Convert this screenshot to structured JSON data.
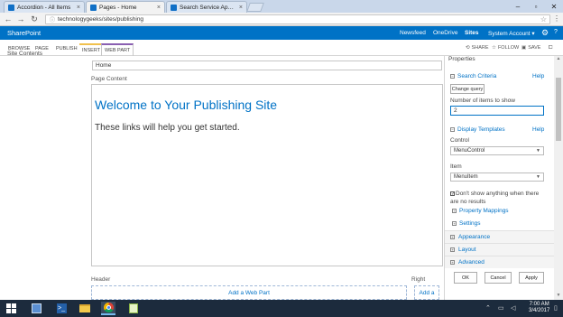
{
  "browser": {
    "tabs": [
      {
        "label": "Accordion - All Items",
        "active": false
      },
      {
        "label": "Pages - Home",
        "active": true
      },
      {
        "label": "Search Service Applicati",
        "active": false
      }
    ],
    "url": "technologygeeks/sites/publishing"
  },
  "suitebar": {
    "brand": "SharePoint",
    "links": [
      "Newsfeed",
      "OneDrive",
      "Sites"
    ],
    "account": "System Account ▾",
    "help": "?"
  },
  "ribbon": {
    "tabs": [
      "BROWSE",
      "PAGE",
      "PUBLISH",
      "INSERT",
      "WEB PART"
    ],
    "actions": [
      "SHARE",
      "FOLLOW",
      "SAVE"
    ]
  },
  "leftnav": {
    "item": "Site Contents"
  },
  "main": {
    "title_value": "Home",
    "content_label": "Page Content",
    "welcome": "Welcome to Your Publishing Site",
    "links_text": "These links will help you get started.",
    "header_label": "Header",
    "right_label": "Right",
    "add_web_part": "Add a Web Part",
    "add_web_part_short": "Add a"
  },
  "toolpane": {
    "title": "Properties",
    "search_criteria": "Search Criteria",
    "help": "Help",
    "change_query": "Change query",
    "items_label": "Number of items to show",
    "items_value": "2",
    "display_templates": "Display Templates",
    "control_label": "Control",
    "control_value": "MenuControl",
    "item_label": "Item",
    "item_value": "MenuItem",
    "no_results_text": "Don't show anything when there are no results",
    "property_mappings": "Property Mappings",
    "settings": "Settings",
    "appearance": "Appearance",
    "layout": "Layout",
    "advanced": "Advanced",
    "ok": "OK",
    "cancel": "Cancel",
    "apply": "Apply"
  },
  "taskbar": {
    "time": "7:00 AM",
    "date": "3/4/2017"
  }
}
